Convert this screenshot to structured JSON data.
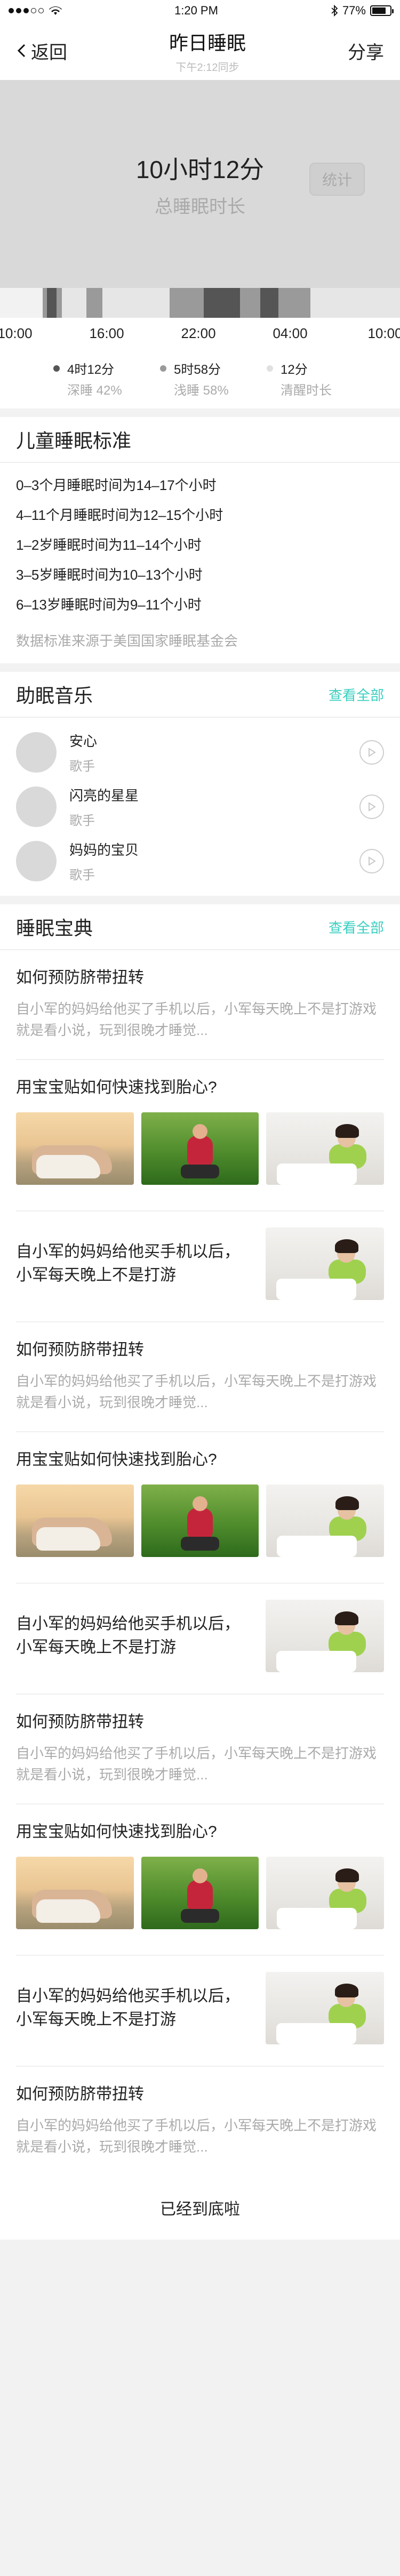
{
  "status_bar": {
    "time": "1:20 PM",
    "battery": "77%",
    "battery_level": 0.77
  },
  "nav": {
    "back_label": "返回",
    "title": "昨日睡眠",
    "subtitle": "下午2:12同步",
    "share_label": "分享"
  },
  "summary": {
    "total_duration": "10小时12分",
    "total_label": "总睡眠时长",
    "stats_button": "统计"
  },
  "timeline": {
    "colors": {
      "deep": "#555555",
      "light": "#9a9a9a",
      "awake": "#e6e6e6",
      "none": "#f2f2f2"
    },
    "segments": [
      [
        "none",
        80
      ],
      [
        "light",
        8
      ],
      [
        "deep",
        18
      ],
      [
        "light",
        10
      ],
      [
        "awake",
        46
      ],
      [
        "light",
        30
      ],
      [
        "awake",
        126
      ],
      [
        "light",
        64
      ],
      [
        "deep",
        68
      ],
      [
        "light",
        38
      ],
      [
        "deep",
        34
      ],
      [
        "light",
        60
      ],
      [
        "awake",
        168
      ]
    ],
    "ticks": [
      "10:00",
      "16:00",
      "22:00",
      "04:00",
      "10:00"
    ]
  },
  "legend": [
    {
      "value": "4时12分",
      "label": "深睡 42%",
      "color": "#555555"
    },
    {
      "value": "5时58分",
      "label": "浅睡 58%",
      "color": "#9a9a9a"
    },
    {
      "value": "12分",
      "label": "清醒时长",
      "color": "#e0e0e0"
    }
  ],
  "standards": {
    "title": "儿童睡眠标准",
    "items": [
      "0–3个月睡眠时间为14–17个小时",
      "4–11个月睡眠时间为12–15个小时",
      "1–2岁睡眠时间为11–14个小时",
      "3–5岁睡眠时间为10–13个小时",
      "6–13岁睡眠时间为9–11个小时"
    ],
    "note": "数据标准来源于美国国家睡眠基金会"
  },
  "music": {
    "title": "助眠音乐",
    "see_all": "查看全部",
    "items": [
      {
        "name": "安心",
        "artist": "歌手"
      },
      {
        "name": "闪亮的星星",
        "artist": "歌手"
      },
      {
        "name": "妈妈的宝贝",
        "artist": "歌手"
      }
    ]
  },
  "guide": {
    "title": "睡眠宝典",
    "see_all": "查看全部",
    "text_title": "如何预防脐带扭转",
    "text_desc": "自小军的妈妈给他买了手机以后，小军每天晚上不是打游戏就是看小说，玩到很晚才睡觉...",
    "gallery_title": "用宝宝贴如何快速找到胎心?",
    "side_title": "自小军的妈妈给他买手机以后，小军每天晚上不是打游",
    "end_label": "已经到底啦"
  }
}
